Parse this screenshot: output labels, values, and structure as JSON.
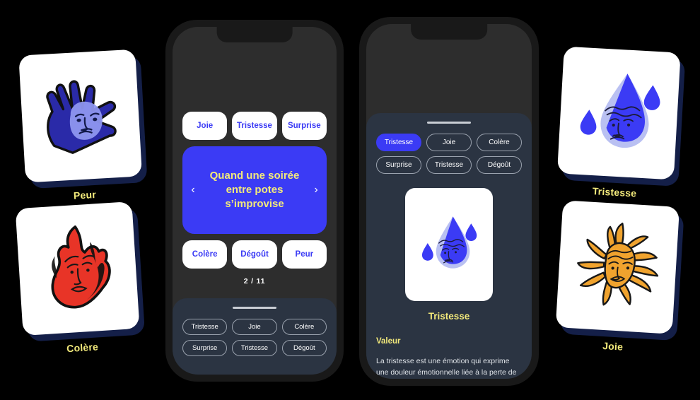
{
  "cards": [
    {
      "id": "peur",
      "label": "Peur",
      "icon": "hand-face-icon",
      "color": "#2a2aa8"
    },
    {
      "id": "colere",
      "label": "Colère",
      "icon": "flame-face-icon",
      "color": "#e83427"
    },
    {
      "id": "tristesse",
      "label": "Tristesse",
      "icon": "teardrop-face-icon",
      "color": "#3b3bf5"
    },
    {
      "id": "joie",
      "label": "Joie",
      "icon": "sun-face-icon",
      "color": "#f0a32e"
    }
  ],
  "phone_one": {
    "answers_top": [
      "Joie",
      "Tristesse",
      "Surprise"
    ],
    "answers_bottom": [
      "Colère",
      "Dégoût",
      "Peur"
    ],
    "question": "Quand une soirée entre potes s’improvise",
    "prev_icon": "chevron-left-icon",
    "next_icon": "chevron-right-icon",
    "counter": "2 / 11",
    "sheet": {
      "handle": "drag-handle",
      "chips": [
        "Tristesse",
        "Joie",
        "Colère",
        "Surprise",
        "Tristesse",
        "Dégoût"
      ]
    }
  },
  "phone_two": {
    "sheet": {
      "handle": "drag-handle",
      "chips": [
        {
          "label": "Tristesse",
          "active": true
        },
        {
          "label": "Joie",
          "active": false
        },
        {
          "label": "Colère",
          "active": false
        },
        {
          "label": "Surprise",
          "active": false
        },
        {
          "label": "Tristesse",
          "active": false
        },
        {
          "label": "Dégoût",
          "active": false
        }
      ]
    },
    "illustration_icon": "teardrop-face-icon",
    "title": "Tristesse",
    "section_label": "Valeur",
    "section_body": "La tristesse est une émotion qui exprime une douleur émotionnelle liée à la perte de quelque chose ou à la"
  },
  "theme": {
    "background": "#000000",
    "accent_blue": "#3b3bf5",
    "accent_yellow": "#f2e97b",
    "sheet_bg": "#2b3442",
    "screen_bg": "#2d2d2d",
    "bezel": "#191919",
    "card_shadow": "#141f48"
  }
}
